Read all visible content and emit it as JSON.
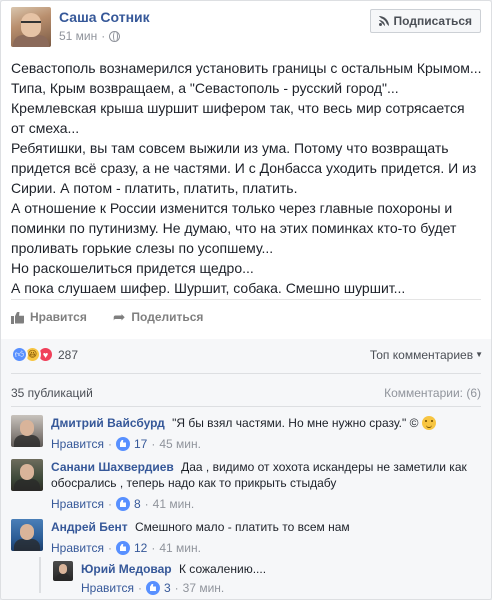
{
  "post": {
    "author": "Саша Сотник",
    "time": "51 мин",
    "privacy_icon": "globe-icon",
    "follow_label": "Подписаться",
    "lines": [
      "Севастополь вознамерился установить границы с остальным Крымом...",
      "Типа, Крым возвращаем, а \"Севастополь - русский город\"...",
      "Кремлевская крыша шуршит шифером так, что весь мир сотрясается",
      "от смеха...",
      "Ребятишки, вы там совсем выжили из ума. Потому что возвращать",
      "придется всё сразу, а не частями. И с Донбасса уходить придется. И из",
      "Сирии. А потом - платить, платить, платить.",
      "А отношение к России изменится только через главные похороны и",
      "поминки по путинизму. Не думаю, что на этих поминках кто-то будет",
      "проливать горькие слезы по усопшему...",
      "Но раскошелиться придется щедро...",
      "А пока слушаем шифер. Шуршит, собака. Смешно шуршит..."
    ]
  },
  "actions": {
    "like_label": "Нравится",
    "share_label": "Поделиться"
  },
  "reactions": {
    "count": "287",
    "top_comments_label": "Топ комментариев"
  },
  "stats": {
    "shares": "35 публикаций",
    "comments": "Комментарии: (6)"
  },
  "comments": [
    {
      "name": "Дмитрий Вайсбурд",
      "text": "\"Я бы взял частями. Но мне нужно сразу.\" ©",
      "like_label": "Нравится",
      "likes": "17",
      "time": "45 мин."
    },
    {
      "name": "Санани Шахвердиев",
      "text": "Даа , видимо от хохота искандеры не заметили как обосрались , теперь надо как то прикрыть стыдабу",
      "like_label": "Нравится",
      "likes": "8",
      "time": "41 мин."
    },
    {
      "name": "Андрей Бент",
      "text": "Смешного мало - платить то всем нам",
      "like_label": "Нравится",
      "likes": "12",
      "time": "41 мин."
    },
    {
      "name": "Юрий Медовар",
      "text": "К сожалению....",
      "like_label": "Нравится",
      "likes": "3",
      "time": "37 мин."
    }
  ],
  "separator": "·",
  "colors": {
    "link": "#365899",
    "like_blue": "#5890ff",
    "meta_grey": "#90949c"
  }
}
